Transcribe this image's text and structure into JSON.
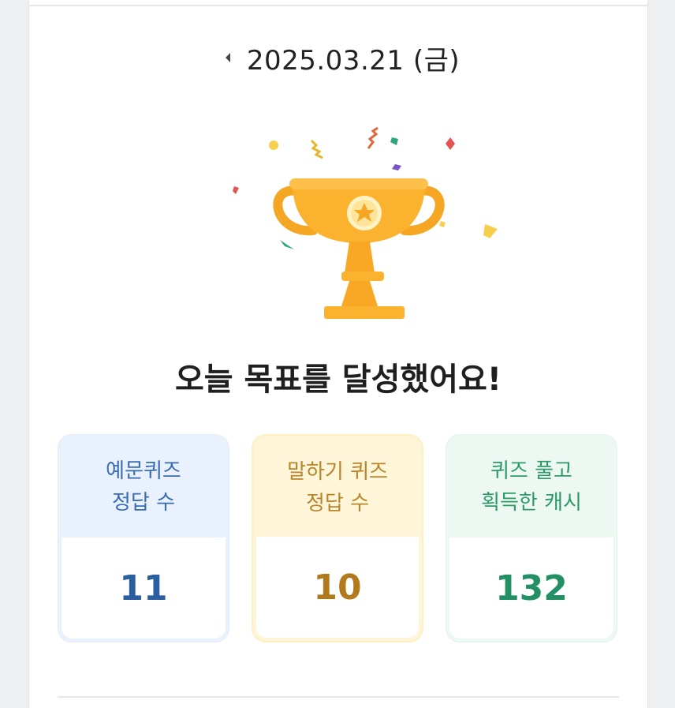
{
  "header": {
    "date": "2025.03.21 (금)"
  },
  "icons": {
    "prev": "caret-left-icon",
    "trophy": "trophy-icon",
    "confetti": "confetti-icon"
  },
  "headline": "오늘 목표를 달성했어요!",
  "stats": [
    {
      "label_line1": "예문퀴즈",
      "label_line2": "정답 수",
      "value": "11",
      "accent": "#2a5e9e"
    },
    {
      "label_line1": "말하기 퀴즈",
      "label_line2": "정답 수",
      "value": "10",
      "accent": "#b27a1d"
    },
    {
      "label_line1": "퀴즈 풀고",
      "label_line2": "획득한 캐시",
      "value": "132",
      "accent": "#229064"
    }
  ],
  "colors": {
    "trophy": "#f9a825",
    "background": "#ffffff"
  }
}
